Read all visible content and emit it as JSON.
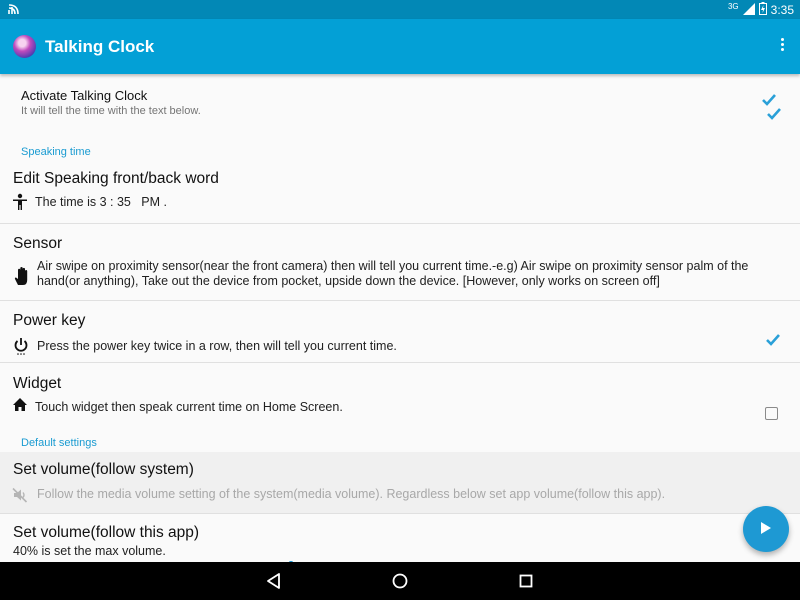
{
  "statusbar": {
    "network": "3G",
    "time": "3:35"
  },
  "appbar": {
    "title": "Talking Clock"
  },
  "activate": {
    "title": "Activate Talking Clock",
    "summary": "It will tell the time with the text below.",
    "checked": true
  },
  "categories": {
    "speaking_time": "Speaking time",
    "default_settings": "Default settings"
  },
  "speaking": {
    "title": "Edit Speaking front/back word",
    "summary": "The time is 3 : 35   PM ."
  },
  "sensor": {
    "title": "Sensor",
    "summary": "Air swipe on proximity sensor(near the front camera) then will tell you current time.-e.g) Air swipe on proximity sensor palm of the hand(or anything), Take out the device from pocket, upside down the device. [However, only works on screen off]",
    "checked": true
  },
  "power_key": {
    "title": "Power key",
    "summary": "Press the power key twice in a row, then will tell you current time.",
    "checked": true
  },
  "widget": {
    "title": "Widget",
    "summary": "Touch widget then speak current time on Home Screen."
  },
  "volume_system": {
    "title": "Set volume(follow system)",
    "summary": "Follow the media volume setting of the system(media volume). Regardless below set app volume(follow this app).",
    "checked": false
  },
  "volume_app": {
    "title": "Set volume(follow this app)",
    "summary": "40% is set the max volume."
  },
  "icons": {
    "speaking": "person-icon",
    "sensor": "hand-icon",
    "power": "power-icon",
    "widget": "home-icon",
    "volume_off": "volume-off-icon",
    "fab": "play-icon"
  },
  "colors": {
    "appbar": "#03a0d6",
    "statusbar": "#0288b6",
    "accent": "#1e99d3"
  }
}
